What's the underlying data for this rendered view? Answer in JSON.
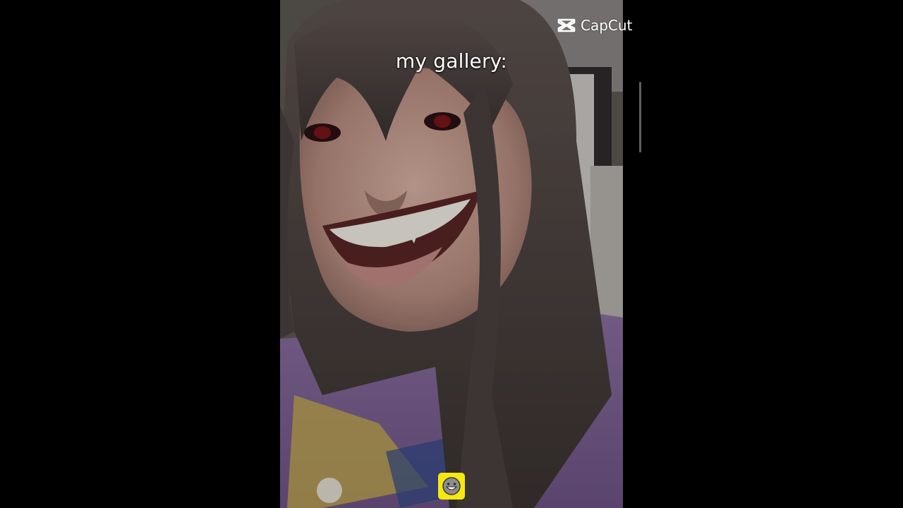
{
  "caption": "my gallery:",
  "watermark": {
    "label": "CapCut",
    "icon": "capcut-logo-icon"
  },
  "sticker": {
    "icon": "grinning-face-sticker-icon",
    "background": "#f5e90f"
  },
  "colors": {
    "page_background": "#000000",
    "caption_text": "#ffffff"
  }
}
